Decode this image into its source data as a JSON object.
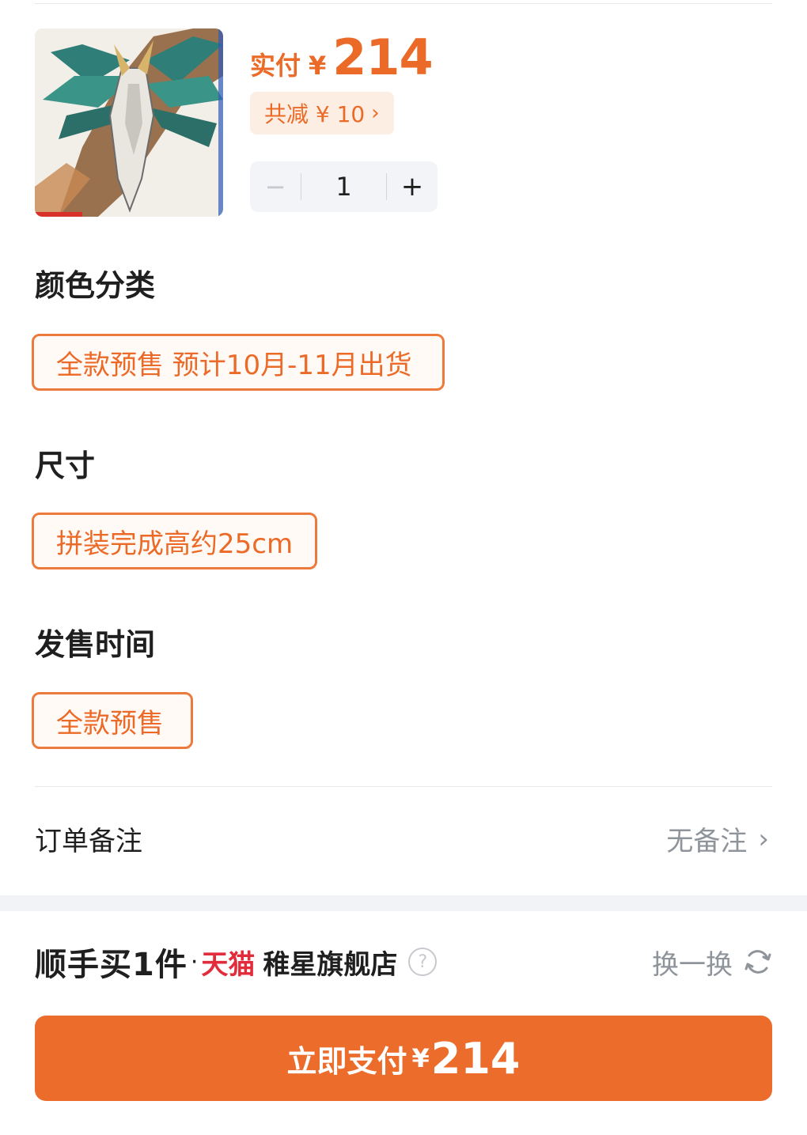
{
  "product": {
    "price_label": "实付",
    "currency": "¥",
    "price": "214",
    "discount_label": "共减 ¥ 10",
    "quantity": "1",
    "minus": "−",
    "plus": "+"
  },
  "sections": [
    {
      "title": "颜色分类",
      "options": [
        "全款预售 预计10月-11月出货"
      ]
    },
    {
      "title": "尺寸",
      "options": [
        "拼装完成高约25cm"
      ]
    },
    {
      "title": "发售时间",
      "options": [
        "全款预售"
      ]
    }
  ],
  "order_note": {
    "label": "订单备注",
    "value": "无备注"
  },
  "promo": {
    "brand": "顺手买1件",
    "tmall": "天猫",
    "store": "稚星旗舰店",
    "help": "?",
    "swap_label": "换一换"
  },
  "pay_button": {
    "label": "立即支付",
    "currency": "¥",
    "amount": "214"
  },
  "colors": {
    "accent": "#ec6a27",
    "tmall_red": "#e22b3b"
  }
}
